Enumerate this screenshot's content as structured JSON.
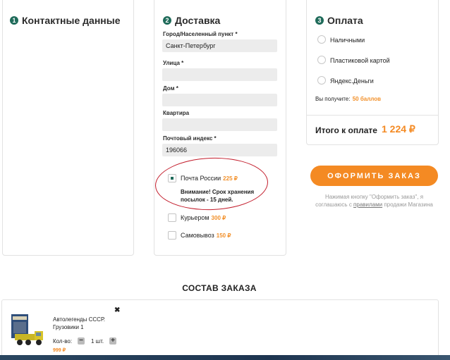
{
  "contacts": {
    "step": "1",
    "title": "Контактные данные"
  },
  "delivery": {
    "step": "2",
    "title": "Доставка",
    "fields": [
      {
        "label": "Город/Населенный пункт *",
        "value": "Санкт-Петербург"
      },
      {
        "label": "Улица *",
        "value": ""
      },
      {
        "label": "Дом *",
        "value": ""
      },
      {
        "label": "Квартира",
        "value": ""
      },
      {
        "label": "Почтовый индекс *",
        "value": "196066"
      }
    ],
    "options": [
      {
        "label": "Почта России",
        "price": "225 ₽",
        "checked": true
      },
      {
        "label": "Курьером",
        "price": "300 ₽",
        "checked": false
      },
      {
        "label": "Самовывоз",
        "price": "150 ₽",
        "checked": false
      }
    ],
    "warning": "Внимание! Срок хранения посылок - 15 дней."
  },
  "payment": {
    "step": "3",
    "title": "Оплата",
    "options": [
      "Наличными",
      "Пластиковой картой",
      "Яндекс.Деньги"
    ],
    "bonus_prefix": "Вы получите:",
    "bonus_value": "50 баллов",
    "total_label": "Итого к оплате",
    "total_value": "1 224 ₽"
  },
  "submit": {
    "label": "ОФОРМИТЬ ЗАКАЗ",
    "consent_before": "Нажимая кнопку \"Оформить заказ\", я соглашаюсь с ",
    "consent_link": "правилами",
    "consent_after": " продажи Магазина"
  },
  "order": {
    "title": "СОСТАВ ЗАКАЗА",
    "items": [
      {
        "name": "Автолегенды СССР. Грузовики 1",
        "qty_label": "Кол-во:",
        "qty": "1 шт.",
        "price": "999 ₽"
      }
    ]
  },
  "colors": {
    "accent": "#f48a23",
    "step": "#1f6b5a",
    "annotation": "#c21b2a"
  },
  "icons": {
    "remove": "close-icon",
    "minus": "minus-icon",
    "plus": "plus-icon"
  }
}
